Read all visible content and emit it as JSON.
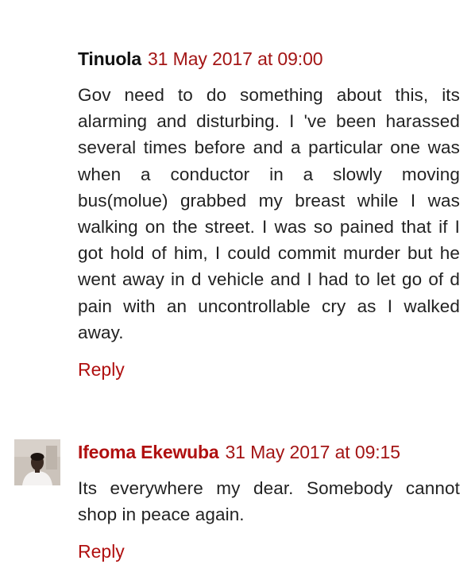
{
  "comments": [
    {
      "author": "Tinuola",
      "timestamp": "31 May 2017 at 09:00",
      "text": "Gov need to do something about this, its alarming and disturbing. I 've been harassed several times before and a particular one was when a conductor in a slowly moving bus(molue) grabbed my breast while I was walking on the street. I was so pained that if I got hold of him, I could commit murder but he went away in d vehicle and I had to let go of d pain with an uncontrollable cry as I walked away.",
      "reply_label": "Reply"
    },
    {
      "author": "Ifeoma Ekewuba",
      "timestamp": "31 May 2017 at 09:15",
      "text": "Its everywhere my dear. Somebody cannot shop in peace again.",
      "reply_label": "Reply"
    }
  ],
  "colors": {
    "link": "#b01010",
    "timestamp": "#a31515",
    "text": "#222222"
  },
  "icons": {
    "avatar": "user-photo-avatar"
  }
}
